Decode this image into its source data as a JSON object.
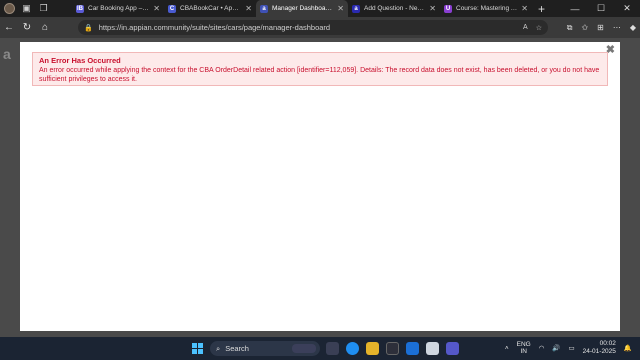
{
  "browser": {
    "tabs": [
      {
        "title": "Car Booking App – Buil",
        "color": "#5b5bd6",
        "glyph": "IB",
        "active": false
      },
      {
        "title": "CBABookCar • Appian S",
        "color": "#4a5bd0",
        "glyph": "C",
        "active": false
      },
      {
        "title": "Manager Dashboard • ",
        "color": "#3f51b5",
        "glyph": "a",
        "active": true
      },
      {
        "title": "Add Question - New to",
        "color": "#2a2ab0",
        "glyph": "a",
        "active": false
      },
      {
        "title": "Course: Mastering App",
        "color": "#8a3fd1",
        "glyph": "U",
        "active": false
      }
    ],
    "url": "https://in.appian.community/suite/sites/cars/page/manager-dashboard"
  },
  "error": {
    "title": "An Error Has Occurred",
    "message": "An error occurred while applying the context for the CBA OrderDetail related action [identifier=112,059]. Details: The record data does not exist, has been deleted, or you do not have sufficient privileges to access it."
  },
  "taskbar": {
    "search_label": "Search",
    "lang_line1": "ENG",
    "lang_line2": "IN",
    "time": "00:02",
    "date": "24-01-2025"
  },
  "page": {
    "bg_logo": "a"
  }
}
